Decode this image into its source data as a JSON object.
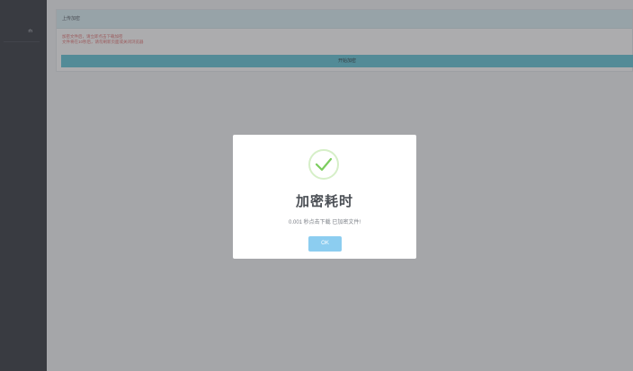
{
  "sidebar": {
    "item_label": "rh"
  },
  "panel": {
    "title": "上传加密",
    "hints": [
      "加密文件后，请立即点击下载加密",
      "文件将在10秒后，请勿刷新页面或关闭浏览器"
    ],
    "button_label": "开始加密"
  },
  "modal": {
    "icon": "checkmark-icon",
    "title": "加密耗时",
    "message": "0.001 秒点击下载 已加密文件!",
    "ok_label": "OK"
  },
  "colors": {
    "sidebar": "#2e3239",
    "accent_bar": "#5ec4d6",
    "success": "#7ccd5e",
    "ok_button": "#8ccdf0"
  }
}
